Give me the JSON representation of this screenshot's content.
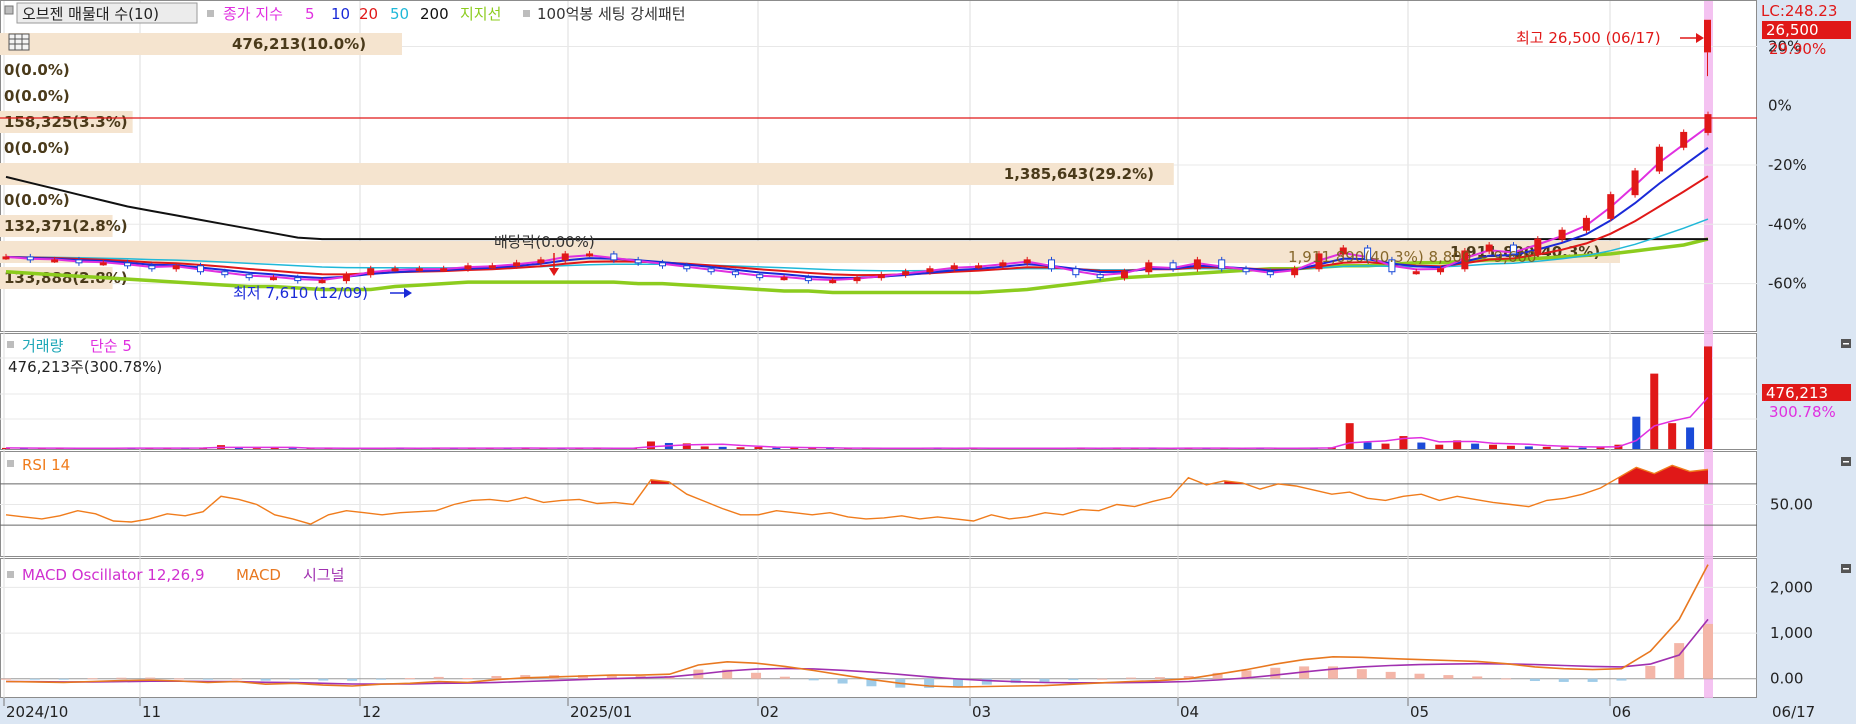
{
  "chart_data": [
    {
      "type": "line",
      "panel": "price",
      "legend": {
        "ovsen_label": "오브젠 매물대 수(10)",
        "ma_prefix": "종가 지수",
        "ma_items": [
          {
            "label": "5",
            "color": "#e030e0"
          },
          {
            "label": "10",
            "color": "#1a2ad8"
          },
          {
            "label": "20",
            "color": "#e01818"
          },
          {
            "label": "50",
            "color": "#20b8d8"
          },
          {
            "label": "200",
            "color": "#111111"
          }
        ],
        "support_label": "지지선",
        "pattern_label": "100억봉 세팅 강세패턴"
      },
      "volume_profile": [
        {
          "label": "476,213(10.0%)",
          "ratio": 0.1
        },
        {
          "label": "0(0.0%)",
          "ratio": 0
        },
        {
          "label": "0(0.0%)",
          "ratio": 0
        },
        {
          "label": "158,325(3.3%)",
          "ratio": 0.033
        },
        {
          "label": "0(0.0%)",
          "ratio": 0
        },
        {
          "label": "1,385,643(29.2%)",
          "ratio": 0.292
        },
        {
          "label": "0(0.0%)",
          "ratio": 0
        },
        {
          "label": "132,371(2.8%)",
          "ratio": 0.028
        },
        {
          "label": "1,911,890(40.3%)",
          "ratio": 0.403
        },
        {
          "label": "133,888(2.8%)",
          "ratio": 0.028
        }
      ],
      "annotations": {
        "high": "최고 26,500 (06/17)",
        "low": "최저 7,610 (12/09)",
        "dividend": "배당락(0.00%)",
        "pattern_box": "1,911,890(40.3%) 8,800 ~ 9,600"
      },
      "y_ticks": [
        "20%",
        "0%",
        "-20%",
        "-40%",
        "-60%"
      ],
      "y_tick_values": [
        20,
        0,
        -20,
        -40,
        -60
      ],
      "y_range": [
        -76,
        35
      ],
      "lc_label": "LC:248.23",
      "last_price": "26,500",
      "last_change": "29.90%",
      "close_series": [
        -51,
        -52,
        -52,
        -53,
        -53,
        -54,
        -55,
        -54,
        -56,
        -57,
        -58,
        -58,
        -59,
        -59,
        -57,
        -55,
        -55,
        -55,
        -55,
        -54,
        -54,
        -53,
        -52,
        -50,
        -50,
        -52,
        -53,
        -54,
        -55,
        -56,
        -57,
        -58,
        -58,
        -59,
        -59,
        -58,
        -57,
        -56,
        -55,
        -54,
        -54,
        -53,
        -52,
        -55,
        -57,
        -58,
        -56,
        -53,
        -55,
        -52,
        -55,
        -56,
        -57,
        -55,
        -50,
        -48,
        -52,
        -56,
        -56,
        -55,
        -49,
        -47,
        -50,
        -45,
        -42,
        -38,
        -30,
        -22,
        -14,
        -9,
        -3
      ],
      "ma200_series": [
        -24,
        -26,
        -28,
        -30,
        -32,
        -34,
        -35.5,
        -37,
        -38.5,
        -40,
        -41.5,
        -43,
        -44.5,
        -45,
        -45,
        -45,
        -45,
        -45,
        -45,
        -45,
        -45,
        -45,
        -45,
        -45,
        -45,
        -45,
        -45,
        -45,
        -45,
        -45,
        -45,
        -45,
        -45,
        -45,
        -45,
        -45,
        -45,
        -45,
        -45,
        -45,
        -45,
        -45,
        -45,
        -45,
        -45,
        -45,
        -45,
        -45,
        -45,
        -45,
        -45,
        -45,
        -45,
        -45,
        -45,
        -45,
        -45,
        -45,
        -45,
        -45,
        -45,
        -45,
        -45,
        -45,
        -45,
        -45,
        -45,
        -45,
        -45,
        -45,
        -45
      ],
      "support_series": [
        -56,
        -56.5,
        -57,
        -57.5,
        -58,
        -58.5,
        -59,
        -59.5,
        -60,
        -60.5,
        -61,
        -61,
        -61.5,
        -62,
        -62,
        -62,
        -61,
        -60.5,
        -60,
        -59.5,
        -59.5,
        -59.5,
        -59.5,
        -59.5,
        -59.5,
        -59.5,
        -60,
        -60,
        -60.5,
        -61,
        -61.5,
        -62,
        -62.5,
        -62.5,
        -63,
        -63,
        -63,
        -63,
        -63,
        -63,
        -63,
        -62.5,
        -62,
        -61,
        -60,
        -59,
        -58,
        -57.5,
        -57,
        -56.5,
        -56,
        -55.5,
        -55,
        -55,
        -54.5,
        -54,
        -54,
        -53.5,
        -53,
        -53,
        -52.5,
        -52,
        -52,
        -51.5,
        -51,
        -50.5,
        -50,
        -49,
        -48,
        -47,
        -45
      ]
    },
    {
      "type": "bar",
      "panel": "volume",
      "title": "거래량",
      "ma_label": "단순 5",
      "value_label": "476,213주(300.78%)",
      "last_value": "476,213",
      "last_change": "300.78%",
      "y_max": 520000,
      "values": [
        5000,
        4000,
        3000,
        4000,
        3000,
        5000,
        4000,
        6000,
        3000,
        4000,
        5000,
        6000,
        18000,
        5000,
        4000,
        5000,
        4000,
        3000,
        4000,
        3000,
        4000,
        5000,
        4000,
        3000,
        4000,
        5000,
        4000,
        5000,
        4000,
        5000,
        4000,
        3000,
        4000,
        4000,
        3000,
        4000,
        35000,
        28000,
        26000,
        12000,
        10000,
        8000,
        9000,
        6000,
        5000,
        4000,
        4000,
        3000,
        4000,
        3000,
        4000,
        5000,
        4000,
        3000,
        4000,
        3000,
        4000,
        3000,
        4000,
        5000,
        4000,
        3000,
        4000,
        5000,
        4000,
        3000,
        4000,
        5000,
        4000,
        3000,
        4000,
        3000,
        4000,
        6000,
        8000,
        120000,
        30000,
        25000,
        60000,
        30000,
        20000,
        40000,
        25000,
        20000,
        15000,
        12000,
        10000,
        8000,
        6000,
        10000,
        20000,
        150000,
        350000,
        120000,
        100000,
        476213
      ],
      "colors": "up red, down blue"
    },
    {
      "type": "line",
      "panel": "rsi",
      "title": "RSI 14",
      "y_ticks": [
        "50.00"
      ],
      "y_tick_values": [
        50
      ],
      "y_range": [
        0,
        100
      ],
      "upper_line": 70,
      "lower_line": 30,
      "values": [
        40,
        38,
        36,
        39,
        44,
        41,
        34,
        33,
        36,
        41,
        39,
        43,
        58,
        55,
        50,
        40,
        36,
        31,
        40,
        44,
        42,
        40,
        42,
        43,
        44,
        50,
        54,
        55,
        53,
        57,
        52,
        54,
        55,
        51,
        52,
        50,
        74,
        72,
        60,
        53,
        46,
        40,
        40,
        44,
        42,
        40,
        42,
        38,
        36,
        37,
        39,
        36,
        38,
        36,
        34,
        40,
        36,
        38,
        42,
        40,
        45,
        44,
        50,
        48,
        53,
        57,
        76,
        69,
        73,
        71,
        65,
        70,
        68,
        64,
        60,
        62,
        56,
        54,
        58,
        60,
        54,
        58,
        55,
        52,
        50,
        48,
        54,
        56,
        60,
        66,
        76,
        86,
        80,
        88,
        82,
        84
      ]
    },
    {
      "type": "line",
      "panel": "macd",
      "title": "MACD Oscillator 12,26,9",
      "macd_label": "MACD",
      "signal_label": "시그널",
      "y_ticks": [
        "2,000",
        "1,000",
        "0.00"
      ],
      "y_tick_values": [
        2000,
        1000,
        0
      ],
      "y_range": [
        -400,
        2600
      ],
      "macd_values": [
        -60,
        -70,
        -80,
        -60,
        -40,
        -30,
        -50,
        -80,
        -60,
        -120,
        -100,
        -140,
        -160,
        -120,
        -100,
        -60,
        -80,
        -20,
        20,
        40,
        60,
        80,
        80,
        100,
        300,
        370,
        340,
        270,
        180,
        80,
        -20,
        -100,
        -160,
        -180,
        -170,
        -160,
        -150,
        -120,
        -90,
        -60,
        -40,
        0,
        100,
        200,
        320,
        420,
        480,
        470,
        440,
        420,
        400,
        380,
        330,
        260,
        220,
        200,
        220,
        600,
        1300,
        2500
      ],
      "signal_values": [
        -60,
        -65,
        -70,
        -70,
        -62,
        -55,
        -55,
        -62,
        -62,
        -78,
        -85,
        -100,
        -115,
        -116,
        -113,
        -100,
        -96,
        -80,
        -60,
        -40,
        -20,
        0,
        20,
        40,
        100,
        170,
        210,
        225,
        215,
        185,
        145,
        95,
        40,
        -5,
        -40,
        -65,
        -82,
        -90,
        -90,
        -85,
        -75,
        -60,
        -28,
        18,
        80,
        150,
        210,
        260,
        290,
        310,
        320,
        330,
        325,
        310,
        290,
        270,
        260,
        320,
        520,
        1300
      ],
      "oscillator_values": [
        0,
        -5,
        -10,
        10,
        22,
        25,
        5,
        -18,
        2,
        -42,
        -15,
        -40,
        -45,
        -4,
        13,
        40,
        16,
        60,
        80,
        80,
        80,
        80,
        60,
        60,
        200,
        200,
        130,
        45,
        -35,
        -105,
        -165,
        -195,
        -200,
        -175,
        -130,
        -95,
        -68,
        -30,
        0,
        25,
        35,
        60,
        128,
        182,
        240,
        270,
        270,
        210,
        150,
        110,
        80,
        50,
        5,
        -50,
        -70,
        -70,
        -40,
        280,
        780,
        1200
      ]
    }
  ],
  "x_axis": {
    "ticks": [
      "2024/10",
      "11",
      "12",
      "2025/01",
      "02",
      "03",
      "04",
      "05",
      "06",
      "06/17"
    ]
  },
  "colors": {
    "up": "#e01818",
    "down": "#1a4ad8",
    "highlight": "#f2b7ee",
    "profile": "#f5e4cf",
    "ma200": "#111111",
    "support": "#8ccc1e",
    "rsi": "#f07c1c",
    "macd_line": "#e87820",
    "signal": "#a030b0",
    "osc_up": "#f4b6a8",
    "osc_down": "#a0cce8",
    "axis_bg": "#dbe6f3"
  },
  "icons": {
    "table": "table-icon",
    "collapse": "collapse-icon"
  }
}
